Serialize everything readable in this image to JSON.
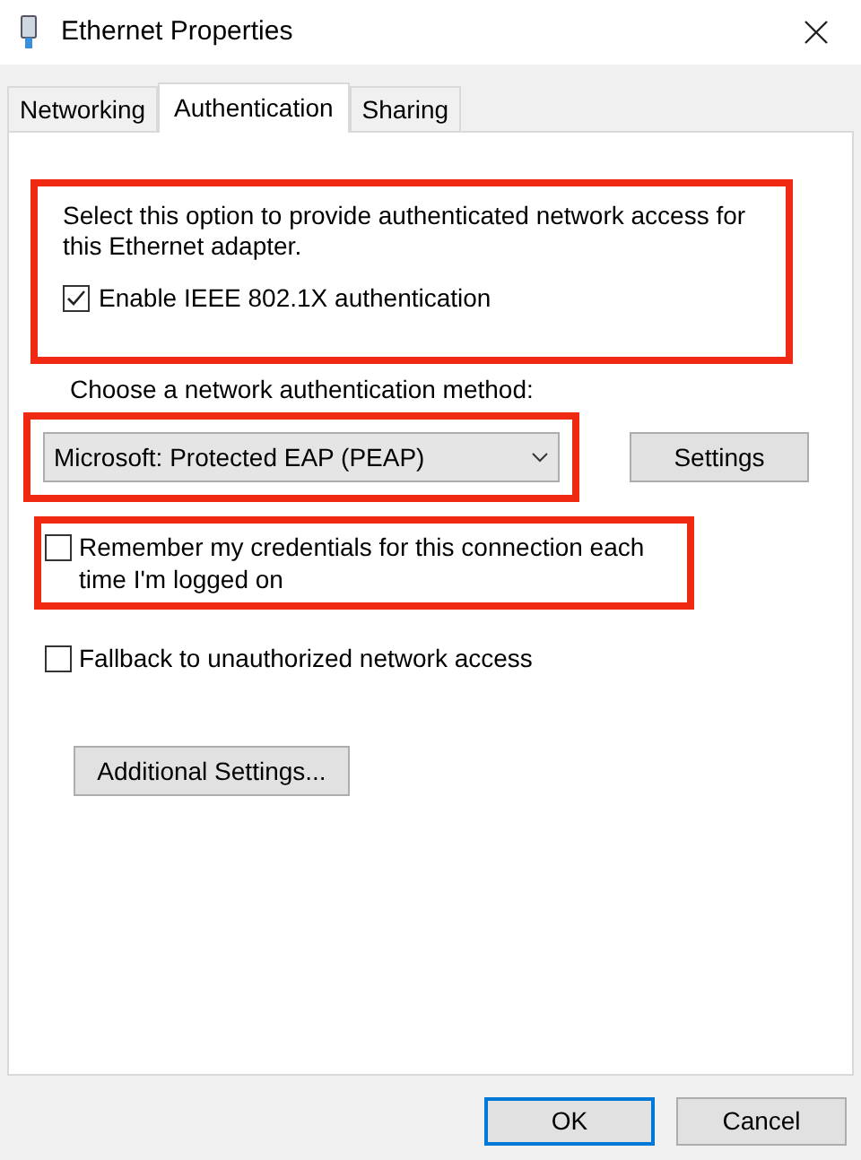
{
  "window": {
    "title": "Ethernet Properties"
  },
  "tabs": [
    {
      "label": "Networking",
      "selected": false
    },
    {
      "label": "Authentication",
      "selected": true
    },
    {
      "label": "Sharing",
      "selected": false
    }
  ],
  "enable_section": {
    "highlighted": true,
    "description": "Select this option to provide authenticated network access for this Ethernet adapter.",
    "checkbox": {
      "label": "Enable IEEE 802.1X authentication",
      "checked": true
    }
  },
  "method": {
    "label": "Choose a network authentication method:",
    "highlighted": true,
    "value": "Microsoft: Protected EAP (PEAP)",
    "settings_button": "Settings"
  },
  "options": [
    {
      "label": "Remember my credentials for this connection each time I'm logged on",
      "checked": false,
      "highlighted": true
    },
    {
      "label": "Fallback to unauthorized network access",
      "checked": false,
      "highlighted": false
    }
  ],
  "additional_button": "Additional Settings...",
  "buttons": [
    {
      "label": "OK",
      "default": true
    },
    {
      "label": "Cancel",
      "default": false
    }
  ]
}
